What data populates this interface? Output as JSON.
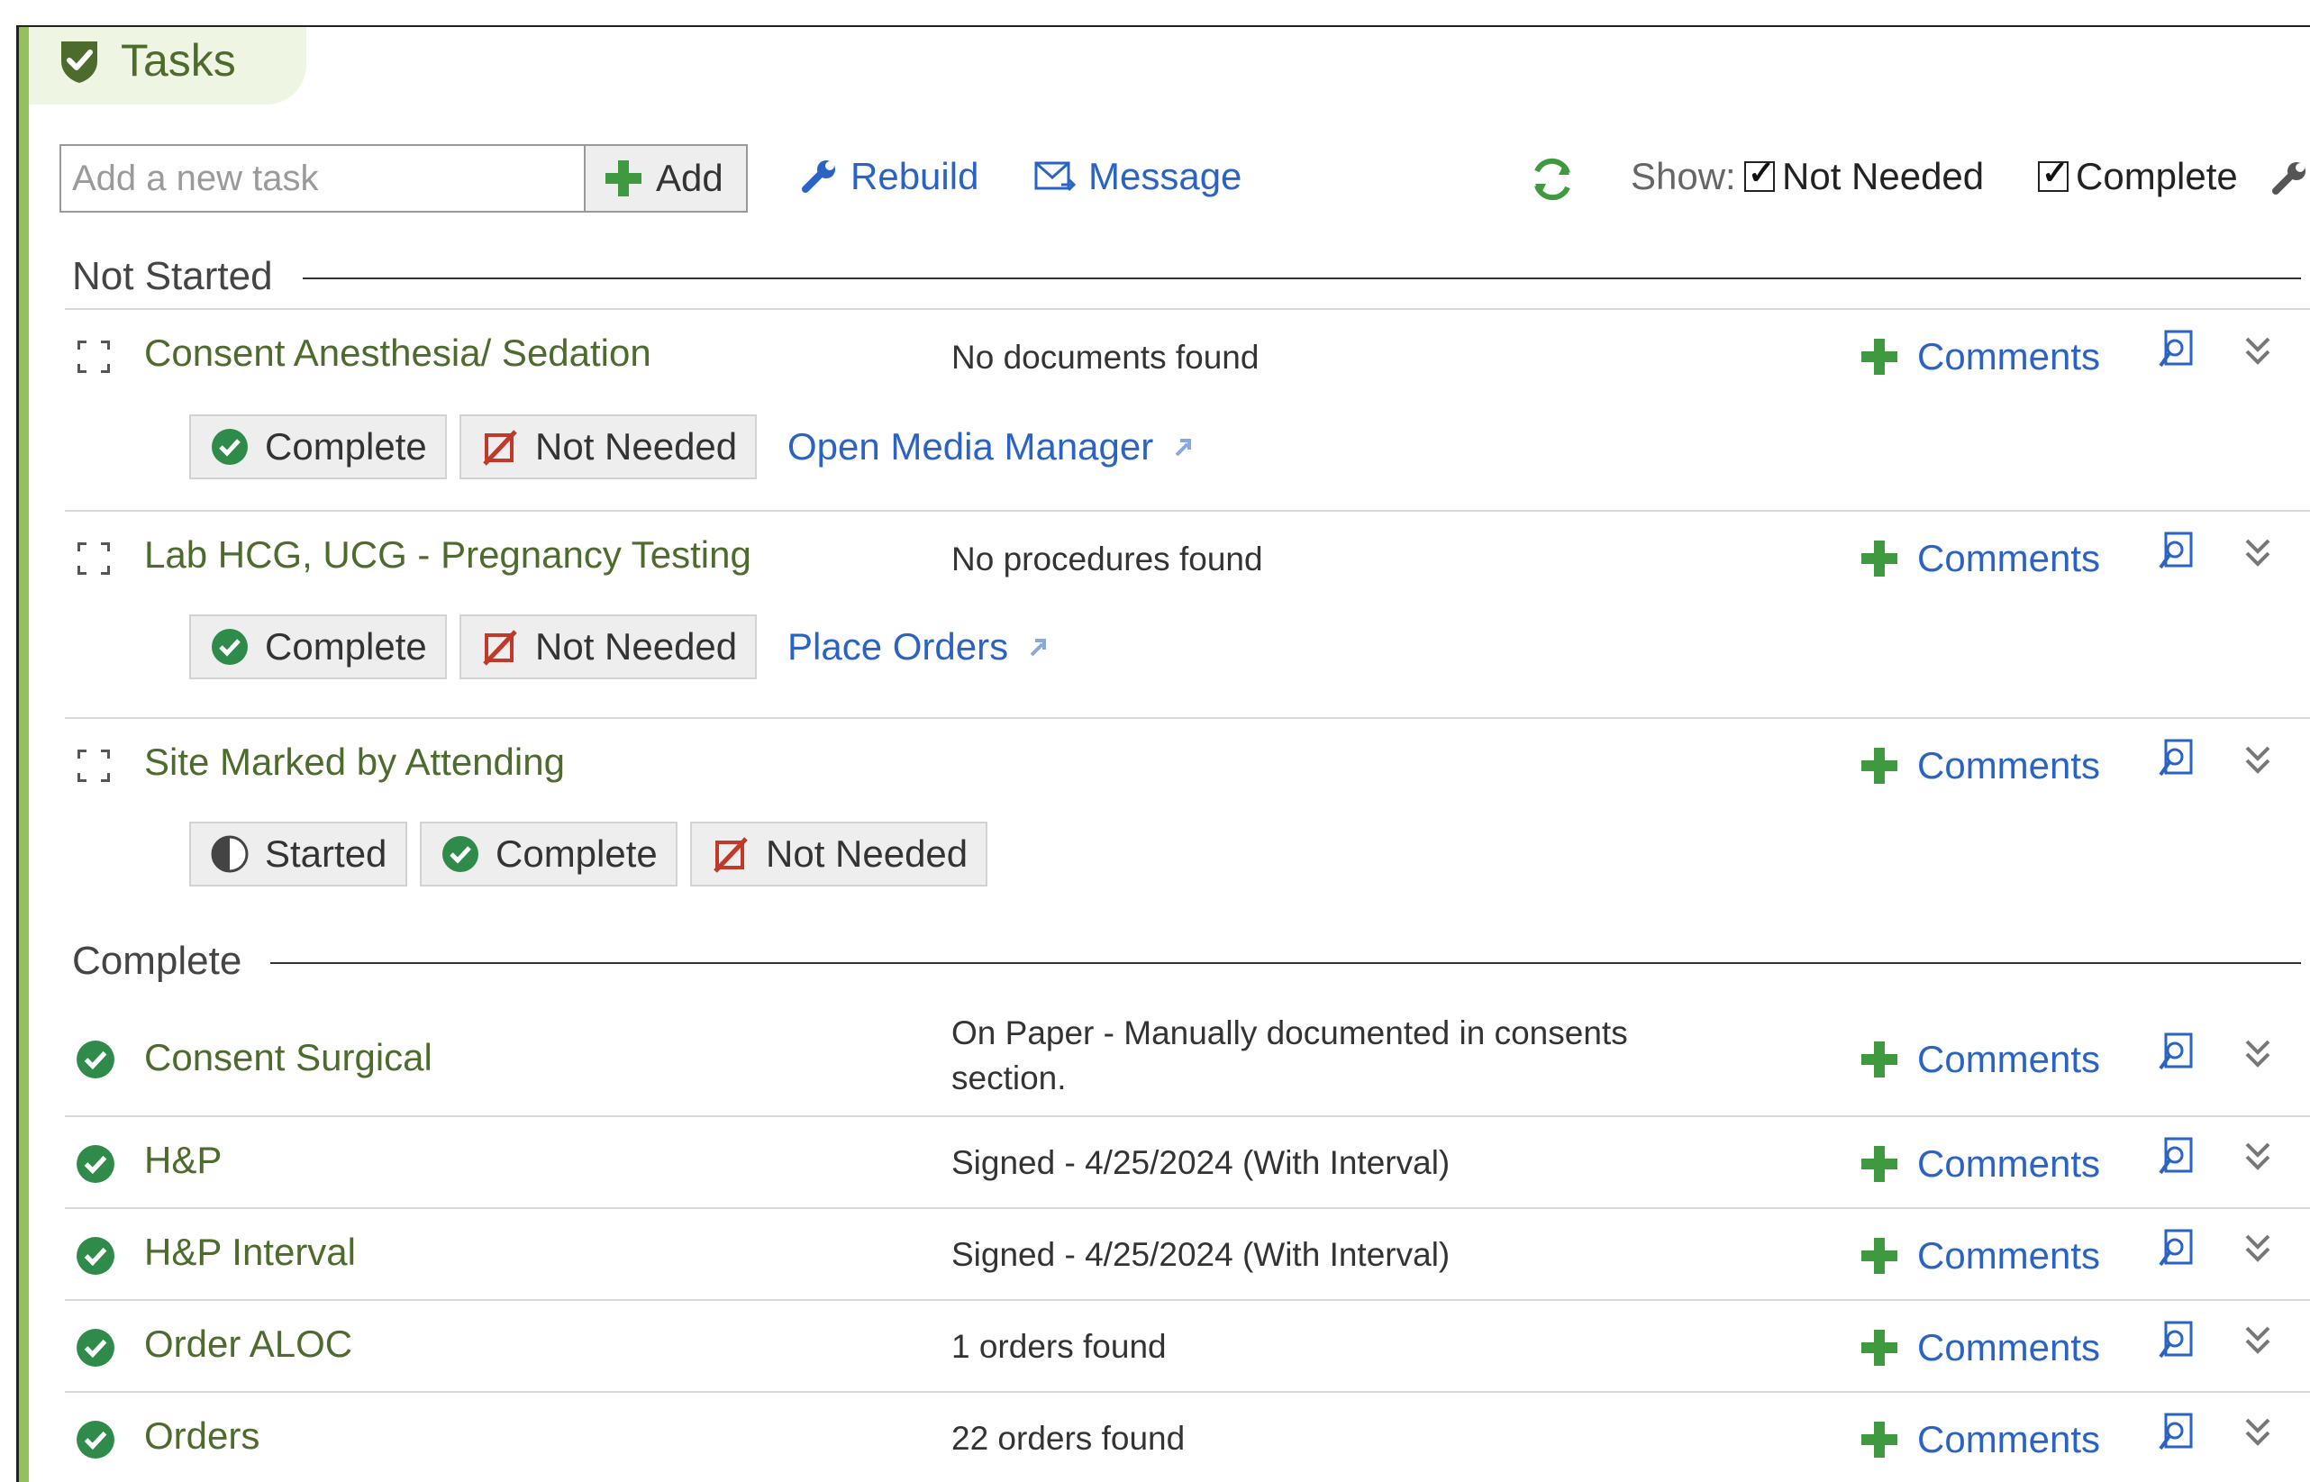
{
  "header": {
    "title": "Tasks"
  },
  "toolbar": {
    "task_placeholder": "Add a new task",
    "add_label": "Add",
    "rebuild_label": "Rebuild",
    "message_label": "Message",
    "show_label": "Show:",
    "filter_not_needed": {
      "label": "Not Needed",
      "checked": true
    },
    "filter_complete": {
      "label": "Complete",
      "checked": true
    }
  },
  "sections": {
    "not_started": {
      "title": "Not Started",
      "tasks": [
        {
          "name": "Consent Anesthesia/ Sedation",
          "status": "No documents found",
          "comments": "Comments",
          "actions": {
            "complete": "Complete",
            "not_needed": "Not Needed",
            "link": "Open Media Manager"
          }
        },
        {
          "name": "Lab HCG, UCG - Pregnancy Testing",
          "status": "No procedures found",
          "comments": "Comments",
          "actions": {
            "complete": "Complete",
            "not_needed": "Not Needed",
            "link": "Place Orders"
          }
        },
        {
          "name": "Site Marked by Attending",
          "status": "",
          "comments": "Comments",
          "actions": {
            "started": "Started",
            "complete": "Complete",
            "not_needed": "Not Needed"
          }
        }
      ]
    },
    "complete": {
      "title": "Complete",
      "tasks": [
        {
          "name": "Consent Surgical",
          "status": "On Paper - Manually documented in consents section.",
          "comments": "Comments"
        },
        {
          "name": "H&P",
          "status": "Signed - 4/25/2024 (With Interval)",
          "comments": "Comments"
        },
        {
          "name": "H&P Interval",
          "status": "Signed - 4/25/2024 (With Interval)",
          "comments": "Comments"
        },
        {
          "name": "Order ALOC",
          "status": "1 orders found",
          "comments": "Comments"
        },
        {
          "name": "Orders",
          "status": "22 orders found",
          "comments": "Comments"
        }
      ]
    }
  },
  "colors": {
    "accent": "#93c25a",
    "task_text": "#4d6b2c",
    "link": "#2b63c5",
    "plus": "#3f9a3f",
    "check": "#2e8b4a",
    "not_needed": "#c0392b"
  }
}
